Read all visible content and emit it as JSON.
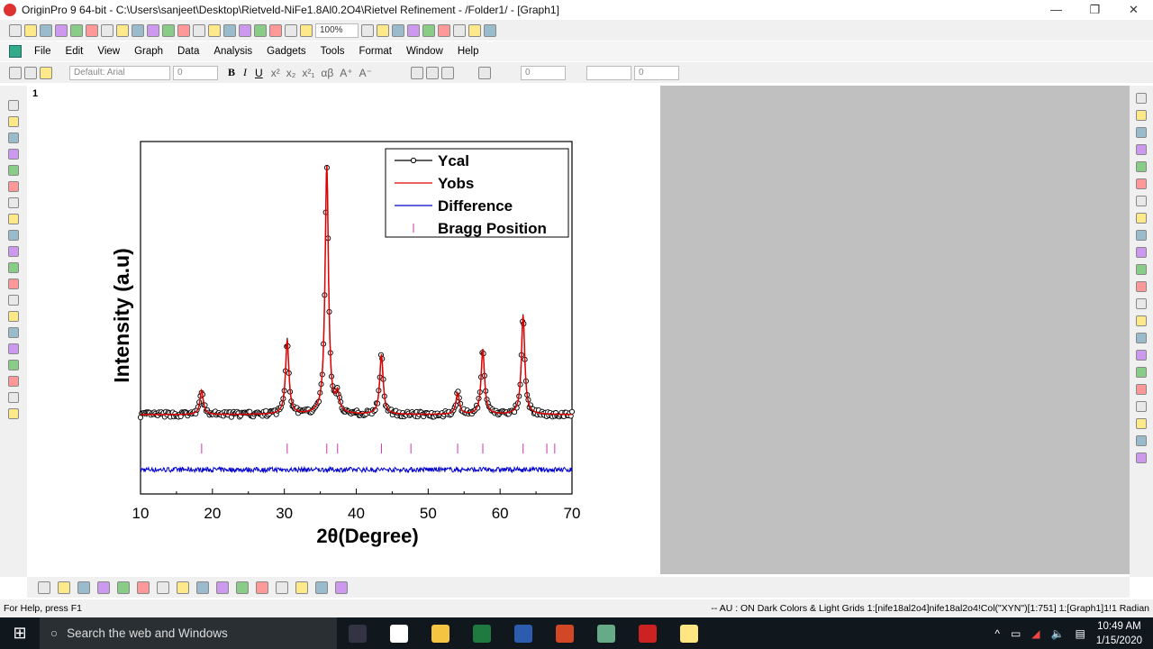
{
  "window": {
    "title": "OriginPro 9 64-bit - C:\\Users\\sanjeet\\Desktop\\Rietveld-NiFe1.8Al0.2O4\\Rietvel Refinement - /Folder1/ - [Graph1]",
    "controls": [
      "—",
      "❐",
      "✕"
    ]
  },
  "toolbar": {
    "zoom": "100%",
    "icons": [
      "new-project",
      "new-folder",
      "new-worksheet",
      "new-excel",
      "new-graph",
      "new-matrix",
      "new-function",
      "new-layout",
      "new-notes",
      "new-3d",
      "open",
      "open-template",
      "open-excel",
      "save",
      "save-template",
      "import-ascii",
      "import-multi",
      "import-wizard",
      "duplicate",
      "batch",
      "print",
      "slideshow",
      "presentation",
      "video",
      "code-builder",
      "results-log",
      "command-window",
      "project-explorer",
      "message-log"
    ]
  },
  "menu": {
    "items": [
      "File",
      "Edit",
      "View",
      "Graph",
      "Data",
      "Analysis",
      "Gadgets",
      "Tools",
      "Format",
      "Window",
      "Help"
    ]
  },
  "format_toolbar": {
    "font": "Default: Arial",
    "size": "0",
    "bold": "B",
    "italic": "I",
    "underline": "U",
    "superscript": "x²",
    "subscript": "x₂",
    "supsub": "x²₁",
    "greek": "αβ",
    "increase": "A⁺",
    "decrease": "A⁻",
    "line_width": "0",
    "pattern_size": "0"
  },
  "page": {
    "number": "1"
  },
  "chart_data": {
    "type": "line",
    "xlabel": "2θ(Degree)",
    "ylabel": "Intensity (a.u)",
    "xlim": [
      10,
      70
    ],
    "xticks": [
      10,
      20,
      30,
      40,
      50,
      60,
      70
    ],
    "ylim": [
      0,
      100
    ],
    "yticks_shown": false,
    "grid": false,
    "legend_placement": "top-right",
    "legend": [
      {
        "name": "Ycal",
        "color": "#000000",
        "marker": "open-circle"
      },
      {
        "name": "Yobs",
        "color": "#e00000"
      },
      {
        "name": "Difference",
        "color": "#0000cc"
      },
      {
        "name": "Bragg Position",
        "color": "#cc33aa",
        "marker": "vertical-tick"
      }
    ],
    "background_level": 22.5,
    "peaks": [
      {
        "x": 18.5,
        "y": 29.4
      },
      {
        "x": 30.4,
        "y": 43.5
      },
      {
        "x": 35.9,
        "y": 93.3
      },
      {
        "x": 37.4,
        "y": 27.6
      },
      {
        "x": 43.5,
        "y": 39.6
      },
      {
        "x": 54.1,
        "y": 28.6
      },
      {
        "x": 57.6,
        "y": 41.0
      },
      {
        "x": 63.2,
        "y": 50.6
      }
    ],
    "difference_level": 6.9,
    "bragg_positions": [
      18.5,
      30.4,
      35.9,
      37.4,
      43.5,
      47.6,
      54.1,
      57.6,
      63.2,
      66.5,
      67.6
    ],
    "bragg_level": 13
  },
  "bottom_toolbar": {
    "icons": [
      "line",
      "scatter",
      "line-symbol",
      "column",
      "stacked",
      "area",
      "fill-area",
      "pie",
      "polar",
      "ternary",
      "contour",
      "3d-surface",
      "3d-bar",
      "waterfall",
      "box",
      "template"
    ]
  },
  "side_tools": {
    "left": [
      "pointer",
      "zoom-in",
      "zoom-out",
      "scale",
      "screen-reader",
      "data-reader",
      "data-selector",
      "draw-data",
      "mask",
      "text",
      "arrow",
      "curved-arrow",
      "line",
      "rectangle",
      "ellipse",
      "pan",
      "region",
      "polygon",
      "circle",
      "print-region"
    ],
    "right": [
      "layer-properties",
      "merge",
      "arrange",
      "extract",
      "add-top-x",
      "add-right-y",
      "add-inset",
      "add-text",
      "axis",
      "fit",
      "rescale",
      "legend",
      "timestamp",
      "table",
      "color-scale",
      "layer-1",
      "layer-2",
      "layer-3",
      "layer-4",
      "layer-5",
      "layer-6",
      "layer-7"
    ]
  },
  "status": {
    "left": "For Help, press F1",
    "right": "-- AU : ON  Dark Colors & Light Grids  1:[nife18al2o4]nife18al2o4!Col(\"XYN\")[1:751]  1:[Graph1]1!1  Radian"
  },
  "taskbar": {
    "search": "Search the web and Windows",
    "apps": [
      "task-view",
      "chrome",
      "file-explorer",
      "excel",
      "word",
      "powerpoint",
      "fps-toolbar",
      "match",
      "notes"
    ],
    "time": "10:49 AM",
    "date": "1/15/2020"
  }
}
